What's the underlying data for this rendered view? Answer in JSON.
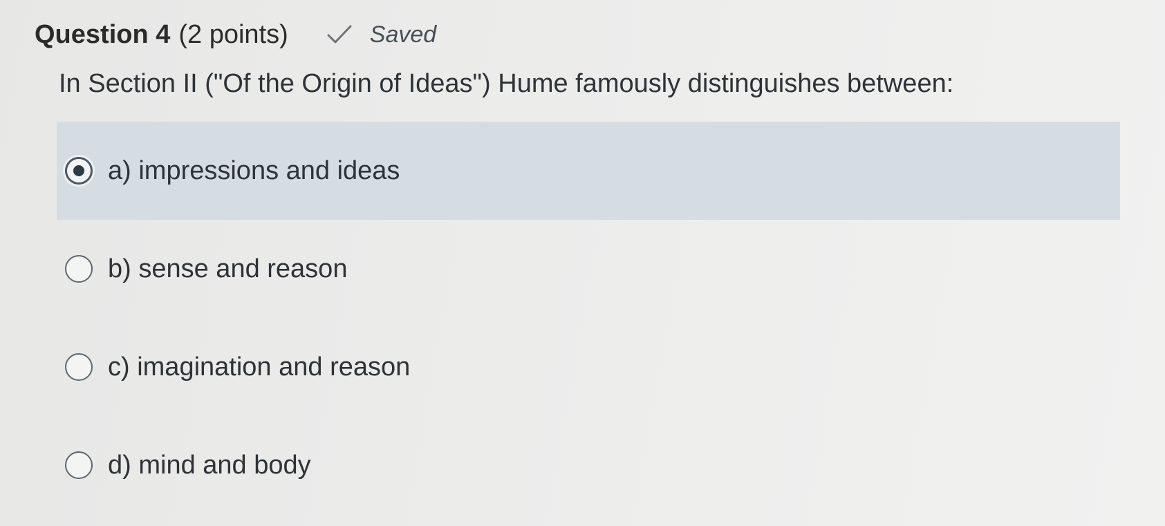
{
  "question": {
    "title": "Question 4",
    "points": "(2 points)",
    "status_icon": "check-icon",
    "status_text": "Saved",
    "prompt": "In Section II (\"Of the Origin of Ideas\") Hume famously distinguishes between:"
  },
  "answers": [
    {
      "label": "a)  impressions and ideas",
      "selected": true
    },
    {
      "label": "b)  sense and reason",
      "selected": false
    },
    {
      "label": "c)  imagination and reason",
      "selected": false
    },
    {
      "label": "d)  mind and body",
      "selected": false
    }
  ],
  "colors": {
    "selected_background": "#d6dde2",
    "text": "#2d3338"
  }
}
